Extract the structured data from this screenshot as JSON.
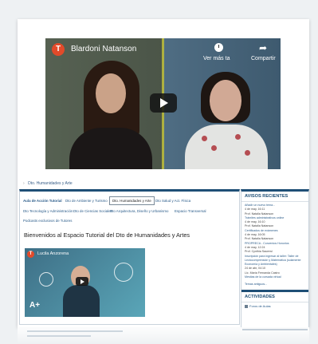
{
  "video_main": {
    "channel_initial": "T",
    "title": "Blardoni Natanson",
    "watch_later": "Ver más ta",
    "share": "Compartir"
  },
  "breadcrumb": {
    "items": [
      "Dto. Humanidades y Arte"
    ]
  },
  "tabs": [
    {
      "label": "Aula de Acción Tutorial",
      "bold": true
    },
    {
      "label": "Dto de Ambiente y Turismo"
    },
    {
      "label": "Dto. Humanidades y Arte",
      "active": true
    },
    {
      "label": "Dto Salud y Act. Física"
    },
    {
      "label": "Dto Tecnología y Administración"
    },
    {
      "label": "Dto de Ciencias Sociales"
    },
    {
      "label": "Dto Arquitectura, Diseño y Urbanismo"
    },
    {
      "label": "Espacio Transversal"
    },
    {
      "label": "Podcasts exclusivos de Tutores"
    }
  ],
  "welcome": "Bienvenidos al Espacio Tutorial del Dto de Humanidades y Artes",
  "video_small": {
    "channel_initial": "T",
    "title": "Lucila Anzorena",
    "badge": "A+"
  },
  "sidebar": {
    "news_title": "AVISOS RECIENTES",
    "news_lines": [
      {
        "text": "Añadir un nuevo tema...",
        "kind": "link"
      },
      {
        "text": "4 de may, 16:11",
        "kind": "meta"
      },
      {
        "text": "Prof. Natalia Natanson",
        "kind": "meta"
      },
      {
        "text": "Trámites administrativos online",
        "kind": "link"
      },
      {
        "text": "4 de may, 16:10",
        "kind": "meta"
      },
      {
        "text": "Prof. Natalia Natanson",
        "kind": "meta"
      },
      {
        "text": "Certificados de exámenes",
        "kind": "link"
      },
      {
        "text": "4 de may, 16:05",
        "kind": "meta"
      },
      {
        "text": "Prof. Natalia Natanson",
        "kind": "meta"
      },
      {
        "text": "PROPRECA - Convenios Honorios",
        "kind": "link"
      },
      {
        "text": "4 de may, 12:24",
        "kind": "meta"
      },
      {
        "text": "Prof. Cynthia Sauerwi",
        "kind": "meta"
      },
      {
        "text": "Inscripción para ingresar al taller: Taller de",
        "kind": "link"
      },
      {
        "text": "Lectocomprensión y Matemática (solamente",
        "kind": "link"
      },
      {
        "text": "Economía y Ambientales)",
        "kind": "link"
      },
      {
        "text": "24 de abr, 04:10",
        "kind": "meta"
      },
      {
        "text": "Lic. María Fernanda Castro",
        "kind": "meta"
      },
      {
        "text": "Mesitas de la cursada virtual",
        "kind": "link"
      }
    ],
    "more": "Temas antiguos...",
    "activities_title": "ACTIVIDADES",
    "activities": [
      "Foros de Aulas"
    ]
  }
}
